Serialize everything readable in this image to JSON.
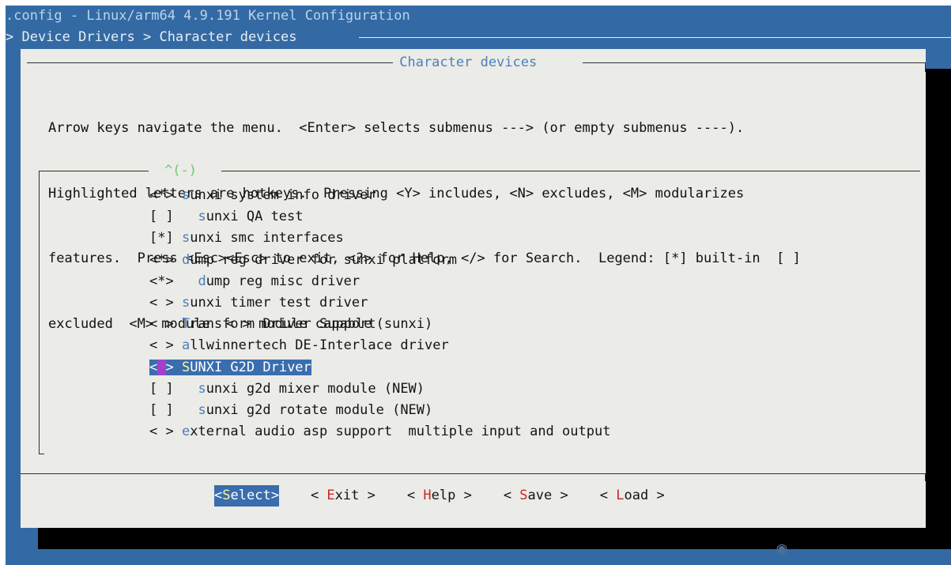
{
  "window": {
    "title": ".config - Linux/arm64 4.9.191 Kernel Configuration",
    "breadcrumb": "> Device Drivers > Character devices "
  },
  "dialog": {
    "title": " Character devices ",
    "help_lines": [
      "Arrow keys navigate the menu.  <Enter> selects submenus ---> (or empty submenus ----).",
      "Highlighted letters are hotkeys.  Pressing <Y> includes, <N> excludes, <M> modularizes",
      "features.  Press <Esc><Esc> to exit, <?> for Help, </> for Search.  Legend: [*] built-in  [ ]",
      "excluded  <M> module  < > module capable"
    ],
    "scroll_indicator": "^(-)"
  },
  "menu": {
    "items": [
      {
        "state": "<*>",
        "indent": " ",
        "hotkey": "s",
        "rest": "unxi system info driver"
      },
      {
        "state": "[ ]",
        "indent": "   ",
        "hotkey": "s",
        "rest": "unxi QA test"
      },
      {
        "state": "[*]",
        "indent": " ",
        "hotkey": "s",
        "rest": "unxi smc interfaces"
      },
      {
        "state": "<*>",
        "indent": " ",
        "hotkey": "d",
        "rest": "ump reg driver for sunxi platform"
      },
      {
        "state": "<*>",
        "indent": "   ",
        "hotkey": "d",
        "rest": "ump reg misc driver"
      },
      {
        "state": "< >",
        "indent": " ",
        "hotkey": "s",
        "rest": "unxi timer test driver"
      },
      {
        "state": "< >",
        "indent": " ",
        "hotkey": "T",
        "rest": "ransform Driver Support(sunxi)"
      },
      {
        "state": "< >",
        "indent": " ",
        "hotkey": "a",
        "rest": "llwinnertech DE-Interlace driver"
      },
      {
        "state_open": "<",
        "state_cursor": " ",
        "state_close": ">",
        "indent": " ",
        "hotkey": "S",
        "rest": "UNXI G2D Driver"
      },
      {
        "state": "[ ]",
        "indent": "   ",
        "hotkey": "s",
        "rest": "unxi g2d mixer module (NEW)"
      },
      {
        "state": "[ ]",
        "indent": "   ",
        "hotkey": "s",
        "rest": "unxi g2d rotate module (NEW)"
      },
      {
        "state": "< >",
        "indent": " ",
        "hotkey": "e",
        "rest": "xternal audio asp support  multiple input and output"
      }
    ],
    "selected_index": 8
  },
  "buttons": [
    {
      "open": "<",
      "hotkey": "S",
      "rest": "elect",
      "close": ">"
    },
    {
      "open": "< ",
      "hotkey": "E",
      "rest": "xit",
      "close": " >"
    },
    {
      "open": "< ",
      "hotkey": "H",
      "rest": "elp",
      "close": " >"
    },
    {
      "open": "< ",
      "hotkey": "S",
      "rest": "ave",
      "close": " >"
    },
    {
      "open": "< ",
      "hotkey": "L",
      "rest": "oad",
      "close": " >"
    }
  ],
  "colors": {
    "background": "#346aa4",
    "dialog": "#ebebe7",
    "hotkey_menu": "#4e7fb8",
    "hotkey_button": "#c52a2a",
    "selection": "#3a6dae",
    "cursor": "#a63fd0"
  }
}
